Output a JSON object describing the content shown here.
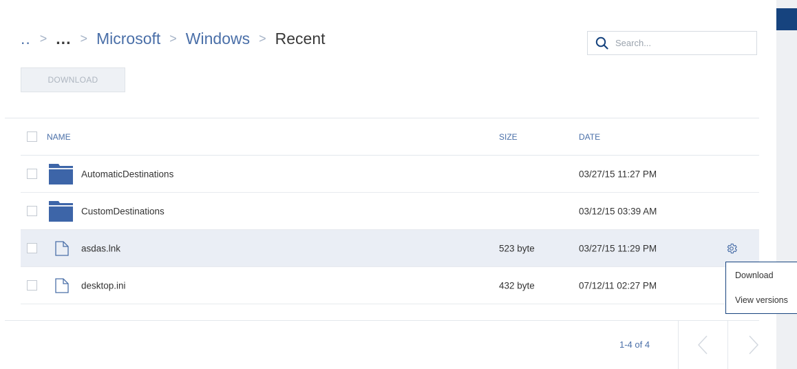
{
  "breadcrumb": {
    "items": [
      {
        "label": ".."
      },
      {
        "label": "..."
      },
      {
        "label": "Microsoft"
      },
      {
        "label": "Windows"
      },
      {
        "label": "Recent"
      }
    ],
    "separator": ">"
  },
  "search": {
    "placeholder": "Search..."
  },
  "toolbar": {
    "download_label": "DOWNLOAD"
  },
  "table": {
    "headers": {
      "name": "NAME",
      "size": "SIZE",
      "date": "DATE"
    },
    "rows": [
      {
        "type": "folder",
        "name": "AutomaticDestinations",
        "size": "",
        "date": "03/27/15 11:27 PM",
        "selected": false
      },
      {
        "type": "folder",
        "name": "CustomDestinations",
        "size": "",
        "date": "03/12/15 03:39 AM",
        "selected": false
      },
      {
        "type": "file",
        "name": "asdas.lnk",
        "size": "523 byte",
        "date": "03/27/15 11:29 PM",
        "selected": true
      },
      {
        "type": "file",
        "name": "desktop.ini",
        "size": "432 byte",
        "date": "07/12/11 02:27 PM",
        "selected": false
      }
    ]
  },
  "context_menu": {
    "items": [
      "Download",
      "View versions"
    ]
  },
  "pagination": {
    "text": "1-4 of 4"
  },
  "colors": {
    "accent": "#4a6fa8",
    "brand": "#16437e",
    "folder": "#3d65a8"
  }
}
